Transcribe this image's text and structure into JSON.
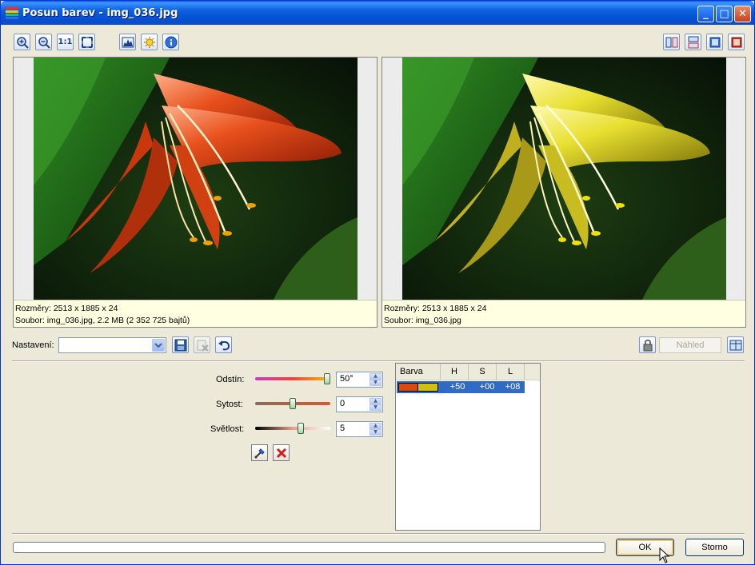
{
  "window": {
    "title": "Posun barev - img_036.jpg",
    "controls": [
      "minimize-icon",
      "maximize-icon",
      "close-icon"
    ]
  },
  "toolbar": {
    "left_icons": [
      "zoom-in-icon",
      "zoom-out-icon",
      "actual-size-icon",
      "fit-to-window-icon",
      "histogram-icon",
      "brightness-icon",
      "info-icon"
    ],
    "actual_size_label": "1:1",
    "right_icons": [
      "split-vertical-icon",
      "split-horizontal-icon",
      "single-view-icon",
      "original-view-icon"
    ]
  },
  "original_panel": {
    "dimensions": "Rozměry: 2513 x 1885 x 24",
    "file": "Soubor: img_036.jpg, 2.2 MB (2 352 725 bajtů)"
  },
  "result_panel": {
    "dimensions": "Rozměry: 2513 x 1885 x 24",
    "file": "Soubor: img_036.jpg"
  },
  "settings": {
    "label": "Nastavení:",
    "value": "",
    "icons": [
      "save-icon",
      "delete-icon",
      "undo-icon"
    ],
    "lock_icon": "lock-icon",
    "preview_label": "Náhled",
    "preview_icon": "preview-split-icon"
  },
  "adjustments": {
    "hue": {
      "label": "Odstín:",
      "value": "50°",
      "level": 1.0
    },
    "saturation": {
      "label": "Sytost:",
      "value": "0",
      "level": 0.5
    },
    "lightness": {
      "label": "Světlost:",
      "value": "5",
      "level": 0.62
    }
  },
  "tools": [
    "eyedropper-icon",
    "remove-icon"
  ],
  "color_table": {
    "headers": [
      "Barva",
      "H",
      "S",
      "L"
    ],
    "rows": [
      {
        "colors": [
          "#d84a10",
          "#d0c010"
        ],
        "h": "+50",
        "s": "+00",
        "l": "+08"
      }
    ]
  },
  "progress": {
    "value": 0
  },
  "buttons": {
    "ok": "OK",
    "cancel": "Storno"
  },
  "colors": {
    "titlebar": "#0b61e0",
    "face": "#ece9d8",
    "info_bg": "#ffffe1",
    "selection": "#316ac5"
  }
}
